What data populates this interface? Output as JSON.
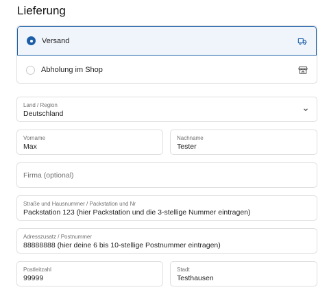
{
  "section": {
    "title": "Lieferung"
  },
  "delivery": {
    "options": [
      {
        "label": "Versand",
        "selected": true,
        "icon": "truck-icon"
      },
      {
        "label": "Abholung im Shop",
        "selected": false,
        "icon": "store-icon"
      }
    ]
  },
  "fields": {
    "country": {
      "label": "Land / Region",
      "value": "Deutschland"
    },
    "first_name": {
      "label": "Vorname",
      "value": "Max"
    },
    "last_name": {
      "label": "Nachname",
      "value": "Tester"
    },
    "company": {
      "placeholder": "Firma (optional)"
    },
    "street": {
      "label": "Straße und Hausnummer / Packstation und Nr",
      "value": "Packstation 123 (hier Packstation und die 3-stellige Nummer eintragen)"
    },
    "address2": {
      "label": "Adresszusatz / Postnummer",
      "value": "88888888 (hier deine 6 bis 10-stellige Postnummer eintragen)"
    },
    "postal_code": {
      "label": "Postleitzahl",
      "value": "99999"
    },
    "city": {
      "label": "Stadt",
      "value": "Testhausen"
    }
  },
  "colors": {
    "accent": "#1c5fa8",
    "selected_bg": "#f0f5fb",
    "border": "#dedede",
    "muted_text": "#707070"
  }
}
